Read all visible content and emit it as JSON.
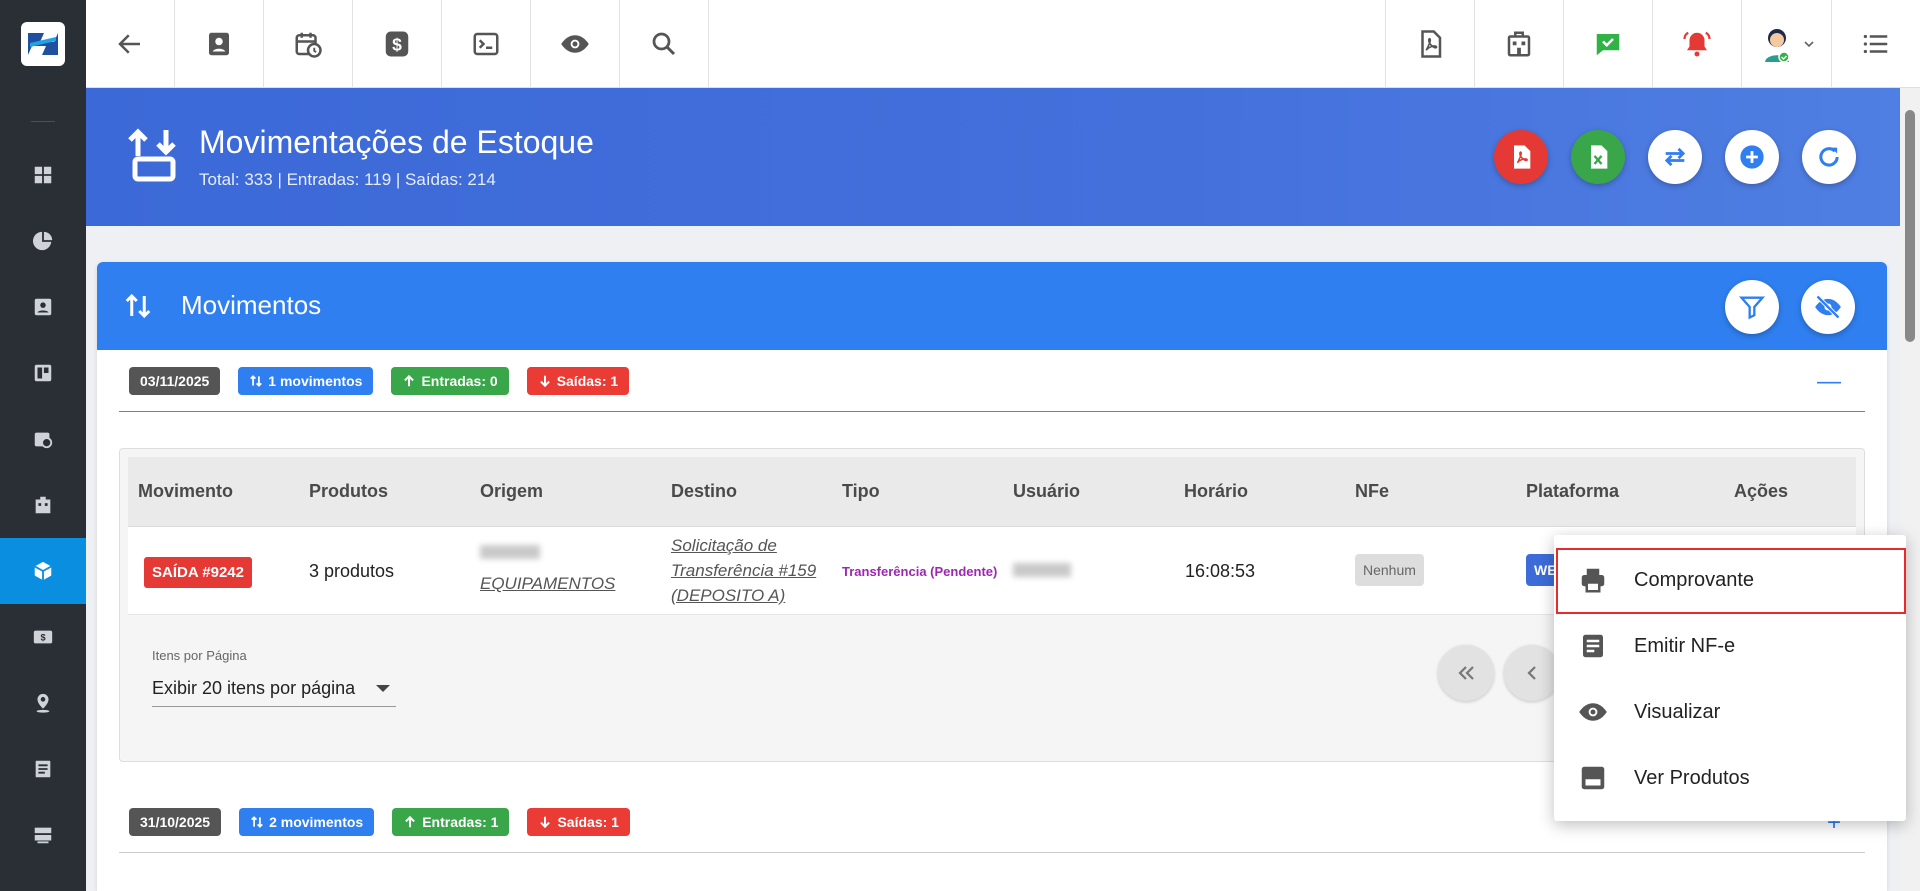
{
  "header": {
    "title": "Movimentações de Estoque",
    "subtitle": "Total: 333 | Entradas: 119 | Saídas: 214"
  },
  "card": {
    "title": "Movimentos"
  },
  "groups": [
    {
      "date": "03/11/2025",
      "movements": "1 movimentos",
      "entradas": "Entradas: 0",
      "saidas": "Saídas: 1",
      "toggle": "—"
    },
    {
      "date": "31/10/2025",
      "movements": "2 movimentos",
      "entradas": "Entradas: 1",
      "saidas": "Saídas: 1",
      "toggle": "+"
    }
  ],
  "table": {
    "columns": [
      "Movimento",
      "Produtos",
      "Origem",
      "Destino",
      "Tipo",
      "Usuário",
      "Horário",
      "NFe",
      "Plataforma",
      "Ações"
    ],
    "row": {
      "movimento": "SAÍDA #9242",
      "produtos": "3 produtos",
      "origem": "EQUIPAMENTOS",
      "destino_line1": "Solicitação de",
      "destino_line2": "Transferência #159",
      "destino_line3": "(DEPOSITO A)",
      "tipo": "Transferência (Pendente)",
      "horario": "16:08:53",
      "nfe": "Nenhum",
      "plataforma": "WE"
    }
  },
  "pagination": {
    "label": "Itens por Página",
    "selected": "Exibir 20 itens por página"
  },
  "menu": {
    "items": [
      "Comprovante",
      "Emitir NF-e",
      "Visualizar",
      "Ver Produtos"
    ]
  },
  "colors": {
    "sidebar": "#2a2f36",
    "active": "#0a8fe0",
    "header_blue": "#4470dc",
    "card_blue": "#2f7ff0",
    "danger": "#e53935",
    "success": "#3aa64a"
  }
}
